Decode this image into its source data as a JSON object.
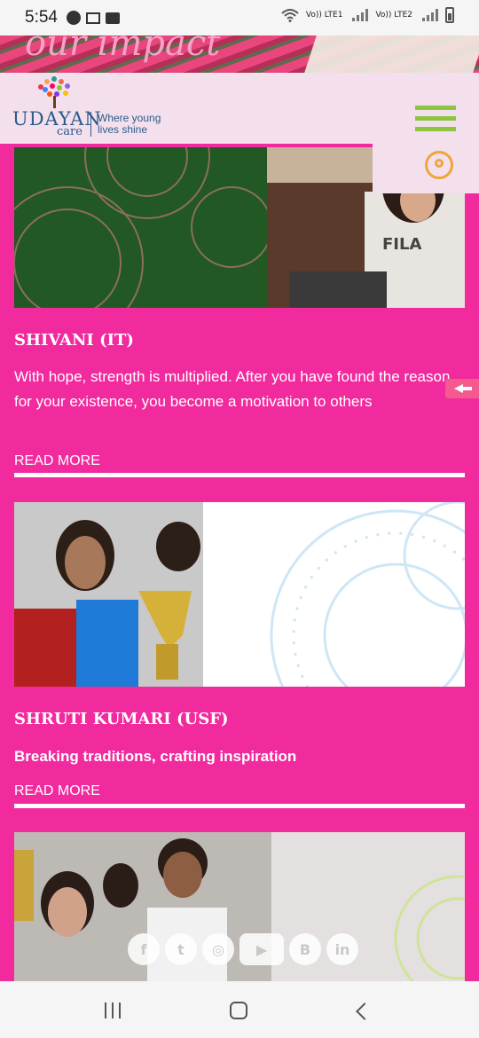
{
  "status_bar": {
    "time": "5:54",
    "sim1": "Vo)) LTE1",
    "sim2": "Vo)) LTE2"
  },
  "hero": {
    "script_text": "our impact"
  },
  "logo": {
    "brand": "UDAYAN",
    "care": "care",
    "tagline_line1": "Where young",
    "tagline_line2": "lives shine"
  },
  "stories": [
    {
      "title": "SHIVANI (IT)",
      "description": "With hope, strength is multiplied. After you have found the reason for your existence, you become a motivation to others",
      "read_more": "READ MORE",
      "shirt_text": "FILA"
    },
    {
      "title": "SHRUTI KUMARI (USF)",
      "description": "Breaking traditions, crafting inspiration",
      "read_more": "READ MORE"
    }
  ],
  "social": [
    "facebook-icon",
    "twitter-icon",
    "instagram-icon",
    "youtube-icon",
    "blogger-icon",
    "linkedin-icon"
  ],
  "social_glyphs": {
    "facebook": "f",
    "twitter": "t",
    "instagram": "◎",
    "youtube": "▶",
    "blogger": "B",
    "linkedin": "in"
  },
  "colors": {
    "page_bg": "#f12a9e",
    "header_bg": "#f3e0ec",
    "menu_green": "#8cc63f",
    "search_orange": "#f2a43a",
    "logo_blue": "#2b5a8c"
  }
}
